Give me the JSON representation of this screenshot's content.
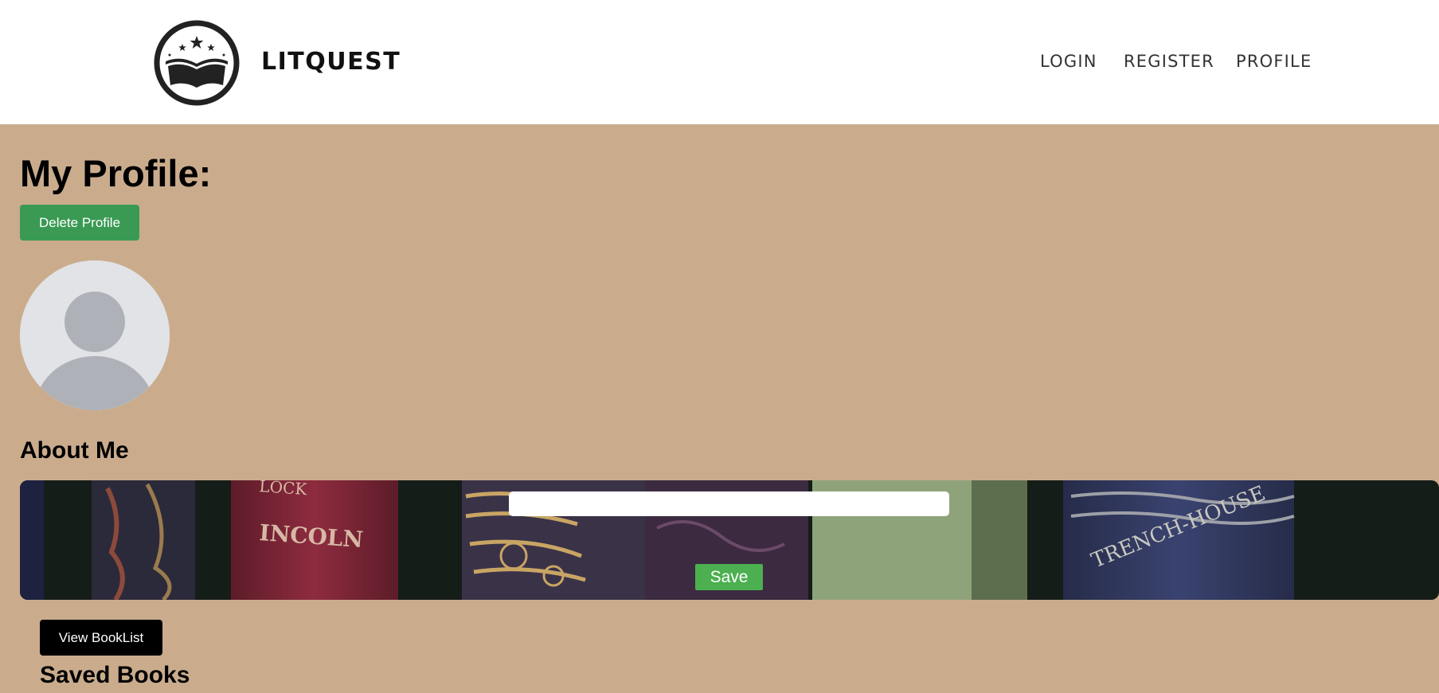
{
  "header": {
    "brand": "LITQUEST",
    "nav": {
      "login": "LOGIN",
      "register": "REGISTER",
      "profile": "PROFILE"
    }
  },
  "profile": {
    "title": "My Profile:",
    "delete_label": "Delete Profile",
    "about_heading": "About Me",
    "about_value": "",
    "save_label": "Save",
    "view_booklist_label": "View BookList",
    "saved_books_heading": "Saved Books"
  },
  "colors": {
    "background": "#caac8d",
    "delete_button": "#3a9a54",
    "save_button": "#4caf50",
    "booklist_button": "#000000"
  },
  "icons": {
    "logo": "open-book-stars-logo",
    "avatar": "default-user-avatar"
  }
}
